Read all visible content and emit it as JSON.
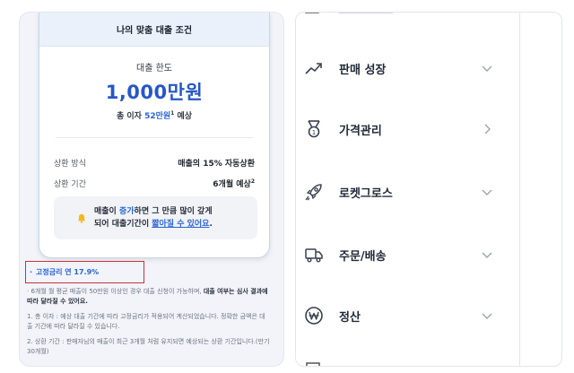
{
  "loan": {
    "header": "나의 맞춤 대출 조건",
    "limit_label": "대출 한도",
    "limit_amount": "1,000만원",
    "interest_prefix": "총 이자 ",
    "interest_value": "52만원",
    "interest_sup": "1",
    "interest_suffix": " 예상",
    "repay_method_label": "상환 방식",
    "repay_method_value": "매출의 15% 자동상환",
    "repay_period_label": "상환 기간",
    "repay_period_value": "6개월 예상",
    "repay_period_sup": "2",
    "notice_line1_a": "매출이 ",
    "notice_line1_b": "증가",
    "notice_line1_c": "하면 그 만큼 많이 갚게",
    "notice_line2_a": "되어 대출기간이 ",
    "notice_line2_b": "짧아질 수 있어요",
    "notice_line2_c": "."
  },
  "rate_note": "고정금리 연 17.9%",
  "footnotes": {
    "f1_a": "6개월 월 평균 매출이 50만원 이상인 경우 대출 신청이 가능하며, ",
    "f1_b": "대출 여부는 심사 결과에 따라 달라질 수 있어요.",
    "f2": "1. 총 이자 : 예상 대출 기간에 따라 고정금리가 적용되어 계산되었습니다. 정확한 금액은 대출 기간에 따라 달라질 수 있습니다.",
    "f3": "2. 상환 기간 : 판매자님의 매출이 최근 3개월 처럼 유지되면 예상되는 상환 기간입니다.(만기 30개월)"
  },
  "menu": {
    "items": [
      {
        "label": "판매 성장",
        "icon": "trend-up-icon",
        "chevron": "down"
      },
      {
        "label": "가격관리",
        "icon": "medal-icon",
        "chevron": "right"
      },
      {
        "label": "로켓그로스",
        "icon": "rocket-icon",
        "chevron": "down"
      },
      {
        "label": "주문/배송",
        "icon": "truck-icon",
        "chevron": "down"
      },
      {
        "label": "정산",
        "icon": "won-coin-icon",
        "chevron": "down"
      }
    ]
  },
  "colors": {
    "accent": "#2656c9",
    "highlight": "#c8323a",
    "bell": "#f5b81c"
  }
}
